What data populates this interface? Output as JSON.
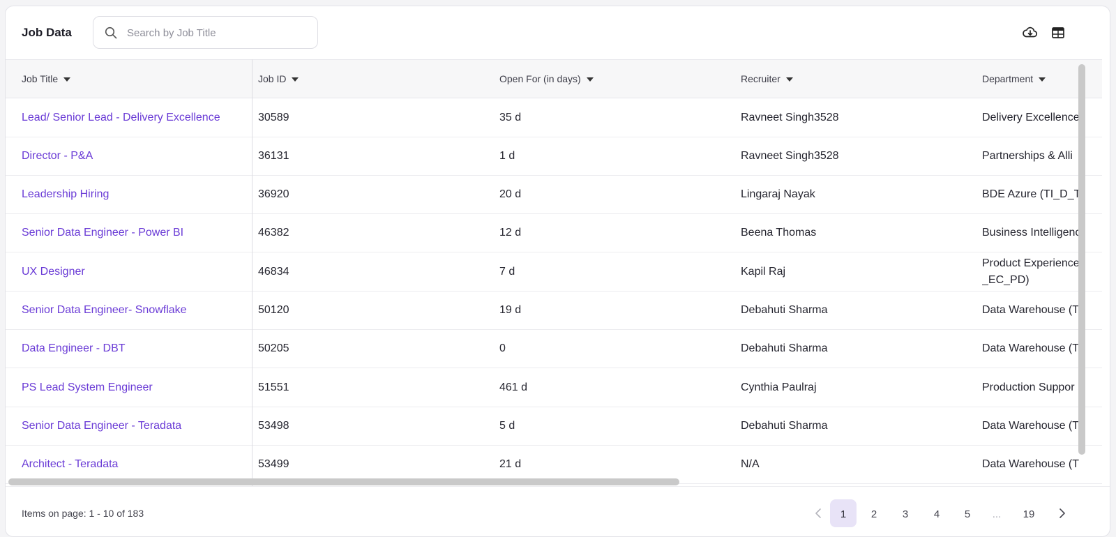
{
  "header": {
    "title": "Job Data",
    "search_placeholder": "Search by Job Title",
    "download_icon": "cloud-download-icon",
    "columns_icon": "table-columns-icon"
  },
  "table": {
    "columns": [
      "Job Title",
      "Job ID",
      "Open For (in days)",
      "Recruiter",
      "Department"
    ],
    "rows": [
      {
        "title": "Lead/ Senior Lead - Delivery Excellence",
        "id": "30589",
        "open": "35 d",
        "recruiter": "Ravneet Singh3528",
        "department": "Delivery Excellence"
      },
      {
        "title": "Director - P&A",
        "id": "36131",
        "open": "1 d",
        "recruiter": "Ravneet Singh3528",
        "department": "Partnerships & Alli"
      },
      {
        "title": "Leadership Hiring",
        "id": "36920",
        "open": "20 d",
        "recruiter": "Lingaraj Nayak",
        "department": "BDE Azure (TI_D_Te"
      },
      {
        "title": "Senior Data Engineer - Power BI",
        "id": "46382",
        "open": "12 d",
        "recruiter": "Beena Thomas",
        "department": "Business Intelligenc"
      },
      {
        "title": "UX Designer",
        "id": "46834",
        "open": "7 d",
        "recruiter": "Kapil Raj",
        "department": "Product Experience _EC_PD)"
      },
      {
        "title": "Senior Data Engineer- Snowflake",
        "id": "50120",
        "open": "19 d",
        "recruiter": "Debahuti Sharma",
        "department": "Data Warehouse (T"
      },
      {
        "title": "Data Engineer - DBT",
        "id": "50205",
        "open": "0",
        "recruiter": "Debahuti Sharma",
        "department": "Data Warehouse (T"
      },
      {
        "title": "PS Lead System Engineer",
        "id": "51551",
        "open": "461 d",
        "recruiter": "Cynthia Paulraj",
        "department": "Production Suppor"
      },
      {
        "title": "Senior Data Engineer - Teradata",
        "id": "53498",
        "open": "5 d",
        "recruiter": "Debahuti Sharma",
        "department": "Data Warehouse (T"
      },
      {
        "title": "Architect - Teradata",
        "id": "53499",
        "open": "21 d",
        "recruiter": "N/A",
        "department": "Data Warehouse (T"
      }
    ]
  },
  "footer": {
    "items_info": "Items on page: 1 - 10 of 183",
    "pages": [
      "1",
      "2",
      "3",
      "4",
      "5",
      "...",
      "19"
    ],
    "current_page": "1",
    "prev_icon": "chevron-left-icon",
    "next_icon": "chevron-right-icon"
  },
  "colors": {
    "link": "#6a3bd6",
    "active_page_bg": "#e8e3f7"
  }
}
